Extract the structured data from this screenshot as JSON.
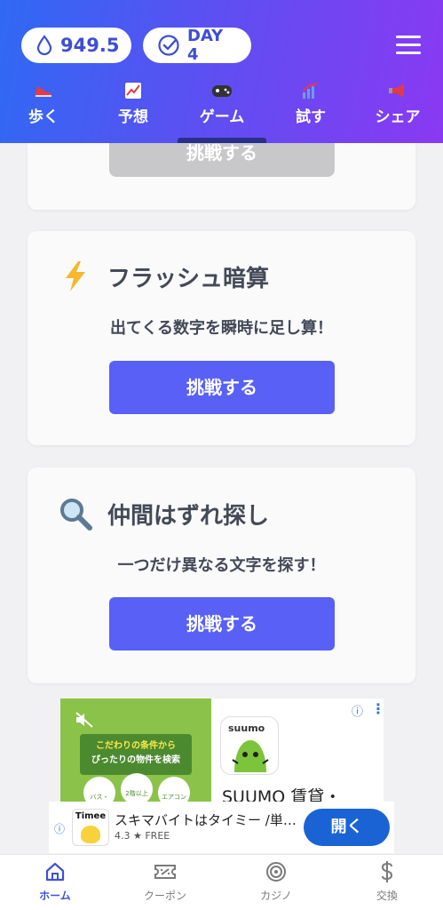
{
  "header": {
    "balance": "949.5",
    "day": "DAY 4",
    "tabs": [
      {
        "label": "歩く",
        "icon": "shoe-icon"
      },
      {
        "label": "予想",
        "icon": "chart-icon"
      },
      {
        "label": "ゲーム",
        "icon": "gamepad-icon"
      },
      {
        "label": "試す",
        "icon": "trend-icon"
      },
      {
        "label": "シェア",
        "icon": "megaphone-icon"
      }
    ],
    "active_tab": "ゲーム"
  },
  "games": {
    "top_button": "挑戦する",
    "items": [
      {
        "title": "フラッシュ暗算",
        "description": "出てくる数字を瞬時に足し算！",
        "button": "挑戦する",
        "icon": "lightning-icon"
      },
      {
        "title": "仲間はずれ探し",
        "description": "一つだけ異なる文字を探す！",
        "button": "挑戦する",
        "icon": "magnifier-icon"
      }
    ]
  },
  "ad": {
    "banner_line1": "こだわりの条件から",
    "banner_line2": "ぴったりの物件を検索",
    "chip1": "バス・",
    "chip2": "2階以上",
    "chip3": "エアコン",
    "brand": "suumo",
    "title": "SUUMO 賃貸・"
  },
  "ad2": {
    "title": "スキマバイトはタイミー /単…",
    "rating": "4.3 ★ FREE",
    "open": "開く",
    "brand": "Timee"
  },
  "bottom_nav": [
    {
      "label": "ホーム",
      "icon": "home-icon"
    },
    {
      "label": "クーポン",
      "icon": "coupon-icon"
    },
    {
      "label": "カジノ",
      "icon": "target-icon"
    },
    {
      "label": "交換",
      "icon": "dollar-icon"
    }
  ],
  "colors": {
    "header_start": "#2f69f4",
    "header_end": "#8a39f2",
    "primary_button": "#5860f5",
    "active_nav": "#3f51d6",
    "open_button": "#1a63d4"
  }
}
